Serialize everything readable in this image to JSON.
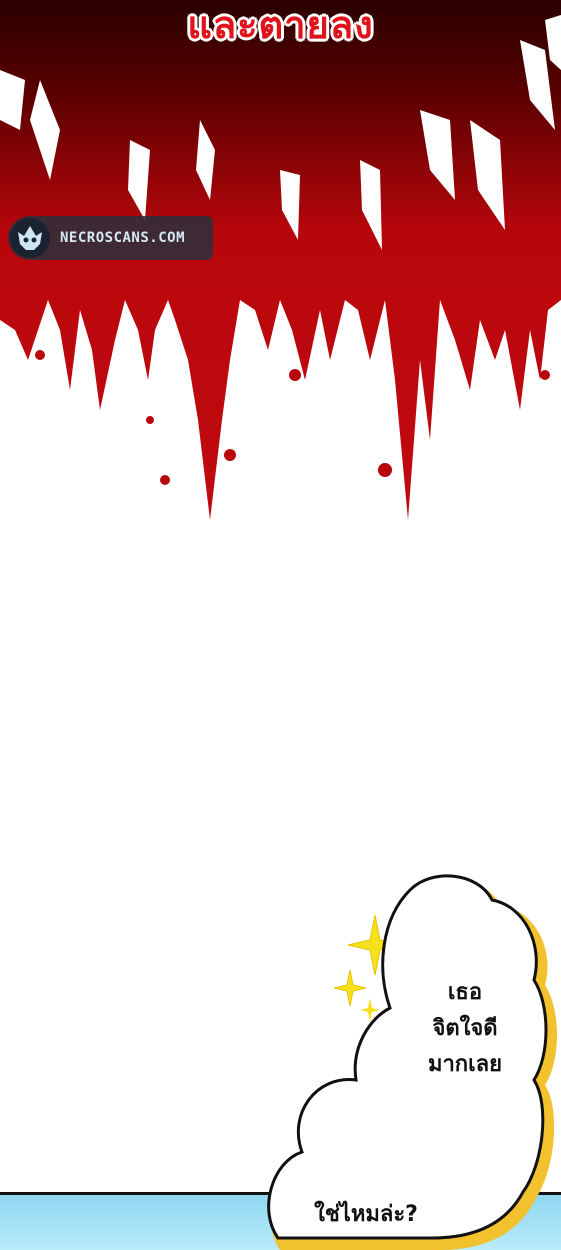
{
  "panel_top": {
    "title": "และตายลง",
    "watermark": {
      "site": "NECROSCANS.COM",
      "logo_icon": "demon-skull-icon"
    },
    "colors": {
      "blood": "#b8070c",
      "blood_dark": "#3a0000",
      "title": "#e0121a"
    }
  },
  "speech_bubble": {
    "lines": [
      "เธอ",
      "จิตใจดี",
      "มากเลย"
    ],
    "question": "ใช่ไหมล่ะ?"
  },
  "sparkle_icon": "sparkle-icon",
  "bottom_strip_color": "#8fd6f0"
}
